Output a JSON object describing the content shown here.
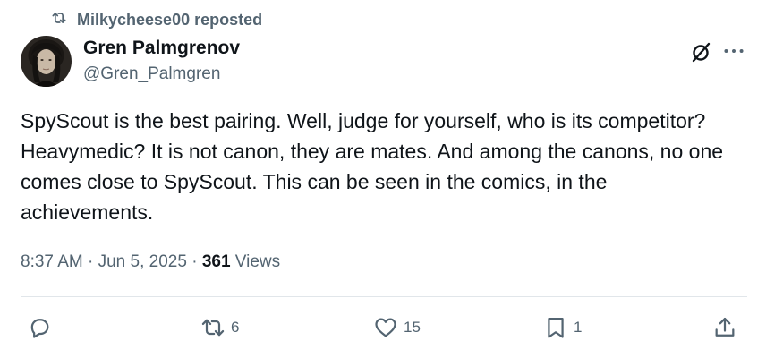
{
  "repost": {
    "text": "Milkycheese00 reposted",
    "icon": "repost-icon"
  },
  "author": {
    "name": "Gren Palmgrenov",
    "handle": "@Gren_Palmgren",
    "avatar": "avatar-image"
  },
  "tweet": {
    "text": "SpyScout is the best pairing. Well, judge for yourself, who is its competitor? Heavymedic? It is not canon, they are mates. And among the canons, no one comes close to SpyScout. This can be seen in the comics, in the achievements."
  },
  "meta": {
    "time": "8:37 AM",
    "sep1": " · ",
    "date": "Jun 5, 2025",
    "sep2": " · ",
    "views_count": "361",
    "views_label": " Views"
  },
  "actions": {
    "reply_count": "",
    "repost_count": "6",
    "like_count": "15",
    "bookmark_count": "1"
  },
  "colors": {
    "text_primary": "#0f1419",
    "text_secondary": "#536471",
    "divider": "#e1e6ea"
  }
}
